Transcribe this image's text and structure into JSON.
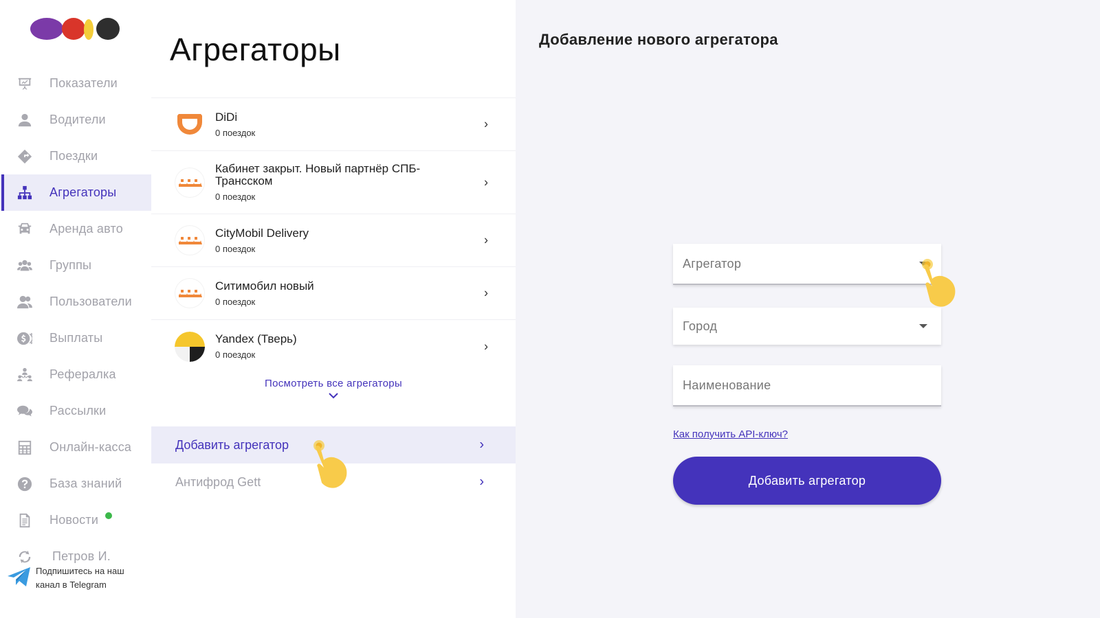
{
  "sidebar": {
    "items": [
      {
        "label": "Показатели",
        "icon": "presentation-chart-icon"
      },
      {
        "label": "Водители",
        "icon": "user-icon"
      },
      {
        "label": "Поездки",
        "icon": "route-sign-icon"
      },
      {
        "label": "Агрегаторы",
        "icon": "hierarchy-icon",
        "active": true
      },
      {
        "label": "Аренда авто",
        "icon": "car-icon"
      },
      {
        "label": "Группы",
        "icon": "group-icon"
      },
      {
        "label": "Пользователи",
        "icon": "users-icon"
      },
      {
        "label": "Выплаты",
        "icon": "dollar-coins-icon"
      },
      {
        "label": "Рефералка",
        "icon": "referral-icon"
      },
      {
        "label": "Рассылки",
        "icon": "chat-bubbles-icon"
      },
      {
        "label": "Онлайн-касса",
        "icon": "calculator-icon"
      },
      {
        "label": "База знаний",
        "icon": "question-icon"
      },
      {
        "label": "Новости",
        "icon": "document-icon"
      }
    ],
    "user": {
      "label": "Петров И.",
      "icon": "refresh-icon"
    },
    "telegram": {
      "line1": "Подпишитесь на наш",
      "line2": "канал в Telegram",
      "icon": "telegram-icon"
    }
  },
  "middle": {
    "title": "Агрегаторы",
    "aggregators": [
      {
        "name": "DiDi",
        "trips": "0 поездок",
        "logo": "didi-logo"
      },
      {
        "name": "Кабинет закрыт. Новый партнёр СПБ-Трансском",
        "trips": "0 поездок",
        "logo": "citymobil-logo"
      },
      {
        "name": "CityMobil Delivery",
        "trips": "0 поездок",
        "logo": "citymobil-logo"
      },
      {
        "name": "Ситимобил новый",
        "trips": "0 поездок",
        "logo": "citymobil-logo"
      },
      {
        "name": "Yandex (Тверь)",
        "trips": "0 поездок",
        "logo": "yandex-logo"
      }
    ],
    "see_all": "Посмотреть все агрегаторы",
    "add_aggregator": "Добавить агрегатор",
    "antifraud": "Антифрод Gett"
  },
  "form": {
    "title": "Добавление нового агрегатора",
    "aggregator_placeholder": "Агрегатор",
    "city_placeholder": "Город",
    "name_placeholder": "Наименование",
    "api_link": "Как получить API-ключ?",
    "submit": "Добавить агрегатор"
  },
  "colors": {
    "accent": "#4433bb",
    "active_bg": "#ececf8",
    "panel_bg": "#f4f4f9",
    "news_dot": "#3cb84a"
  }
}
